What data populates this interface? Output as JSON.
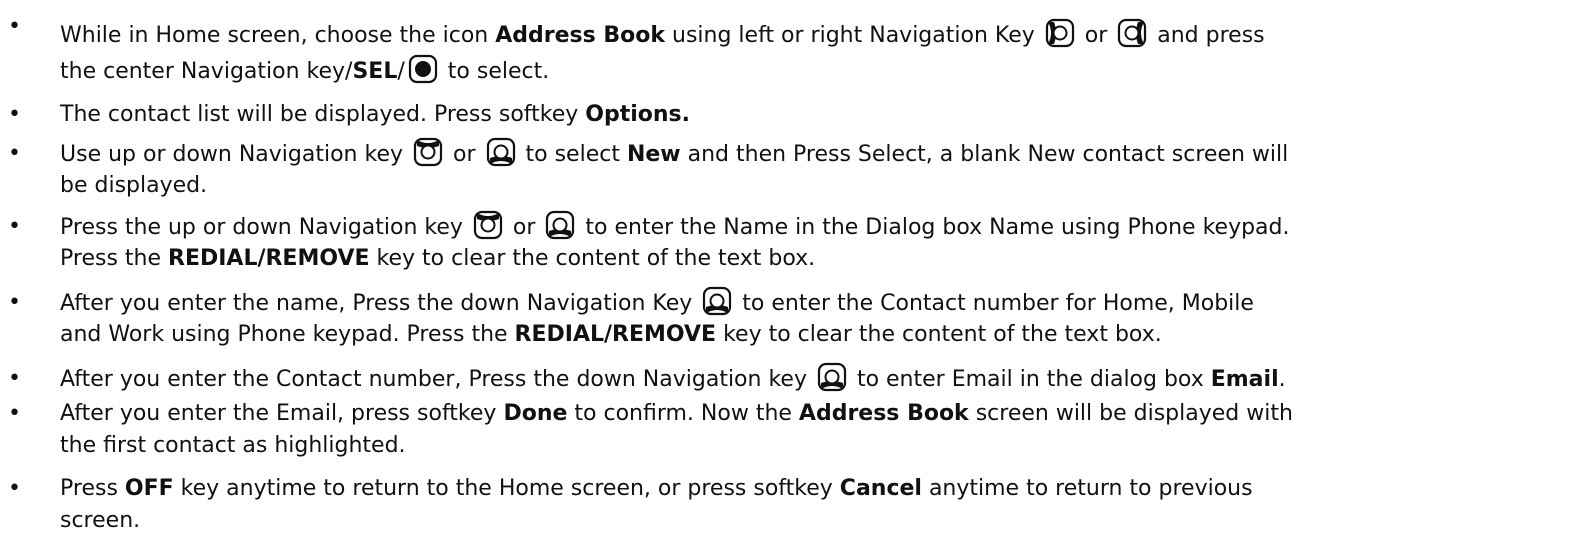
{
  "steps": [
    {
      "lines": [
        [
          "While in Home screen, choose the icon ",
          {
            "b": "Address Book"
          },
          " using left or right Navigation Key ",
          {
            "icon": "nav-left-key-icon"
          },
          " or ",
          {
            "icon": "nav-right-key-icon"
          },
          "  and press"
        ],
        [
          "the center Navigation key/",
          {
            "b": "SEL"
          },
          "/",
          {
            "icon": "nav-center-key-icon"
          },
          " to select."
        ]
      ]
    },
    {
      "lines": [
        [
          "The contact list will be displayed. Press softkey ",
          {
            "b": "Options."
          }
        ]
      ]
    },
    {
      "lines": [
        [
          "Use up or down Navigation key ",
          {
            "icon": "nav-up-key-icon"
          },
          " or ",
          {
            "icon": "nav-down-key-icon"
          },
          "  to select ",
          {
            "b": "New"
          },
          " and then Press Select, a blank New contact screen will"
        ],
        [
          "be displayed."
        ]
      ]
    },
    {
      "lines": [
        [
          "Press the up or down Navigation key ",
          {
            "icon": "nav-up-key-icon"
          },
          " or ",
          {
            "icon": "nav-down-key-icon"
          },
          "  to enter the Name in the Dialog box Name using Phone keypad."
        ],
        [
          "Press the ",
          {
            "b": "REDIAL/REMOVE"
          },
          " key to clear the content of the text box."
        ]
      ]
    },
    {
      "lines": [
        [
          "After you enter the name, Press the down Navigation Key ",
          {
            "icon": "nav-down-key-icon"
          },
          "  to enter the Contact number for Home, Mobile"
        ],
        [
          "and Work using Phone keypad. Press the ",
          {
            "b": "REDIAL/REMOVE"
          },
          " key to clear the content of the text box."
        ]
      ]
    },
    {
      "lines": [
        [
          "After you enter the Contact number, Press the down Navigation key ",
          {
            "icon": "nav-down-key-icon"
          },
          "  to enter Email in the dialog box ",
          {
            "b": "Email"
          },
          "."
        ]
      ]
    },
    {
      "lines": [
        [
          "After you enter the Email, press softkey ",
          {
            "b": "Done"
          },
          " to confirm. Now the ",
          {
            "b": "Address Book"
          },
          " screen will be displayed with"
        ],
        [
          "the first contact as highlighted."
        ]
      ]
    },
    {
      "lines": [
        [
          "Press ",
          {
            "b": "OFF"
          },
          " key anytime to return to the Home screen, or press softkey ",
          {
            "b": "Cancel"
          },
          " anytime to return to previous"
        ],
        [
          "screen."
        ]
      ]
    }
  ]
}
